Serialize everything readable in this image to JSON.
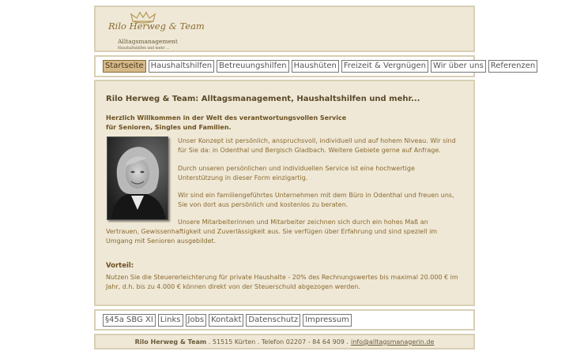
{
  "header": {
    "logo_name": "Rilo Herweg & Team",
    "logo_subtitle": "Alltagsmanagement",
    "logo_tagline": "Haushaltshilfen und mehr ..."
  },
  "nav": {
    "items": [
      "Startseite",
      "Haushaltshilfen",
      "Betreuungshilfen",
      "Haushüten",
      "Freizeit & Vergnügen",
      "Wir über uns",
      "Referenzen"
    ],
    "active": "Startseite"
  },
  "main": {
    "title": "Rilo Herweg & Team: Alltagsmanagement, Haushaltshilfen und mehr...",
    "welcome_line1": "Herzlich Willkommen in der Welt des verantwortungsvollen Service",
    "welcome_line2": "für Senioren, Singles und Familien.",
    "paragraphs": [
      "Unser Konzept ist persönlich, anspruchsvoll, individuell und auf hohem Niveau. Wir sind für Sie da: in Odenthal und Bergisch Gladbach. Weitere Gebiete gerne auf Anfrage.",
      "Durch unseren persönlichen und individuellen Service ist eine hochwertige Unterstützung in dieser Form einzigartig.",
      "Wir sind ein familiengeführtes Unternehmen mit dem Büro in Odenthal und freuen uns, Sie von dort aus persönlich und kostenlos zu beraten.",
      "Unsere Mitarbeiterinnen und Mitarbeiter zeichnen sich durch ein hohes Maß an Vertrauen, Gewissenhaftigkeit und Zuverlässigkeit aus. Sie verfügen über Erfahrung und sind speziell im Umgang mit Senioren ausgebildet."
    ],
    "vorteil_label": "Vorteil:",
    "vorteil_text": "Nutzen Sie die Steuererleichterung für private Haushalte - 20% des Rechnungswertes bis maximal 20.000 € im Jahr, d.h. bis zu 4.000 € können direkt von der Steuerschuld abgezogen werden."
  },
  "bottom_nav": {
    "items": [
      "§45a SBG XI",
      "Links",
      "Jobs",
      "Kontakt",
      "Datenschutz",
      "Impressum"
    ]
  },
  "footer": {
    "company": "Rilo Herweg & Team",
    "address": " . 51515 Kürten . Telefon 02207 - 84 64 909 .",
    "email": "info@alltagsmanagerin.de"
  }
}
